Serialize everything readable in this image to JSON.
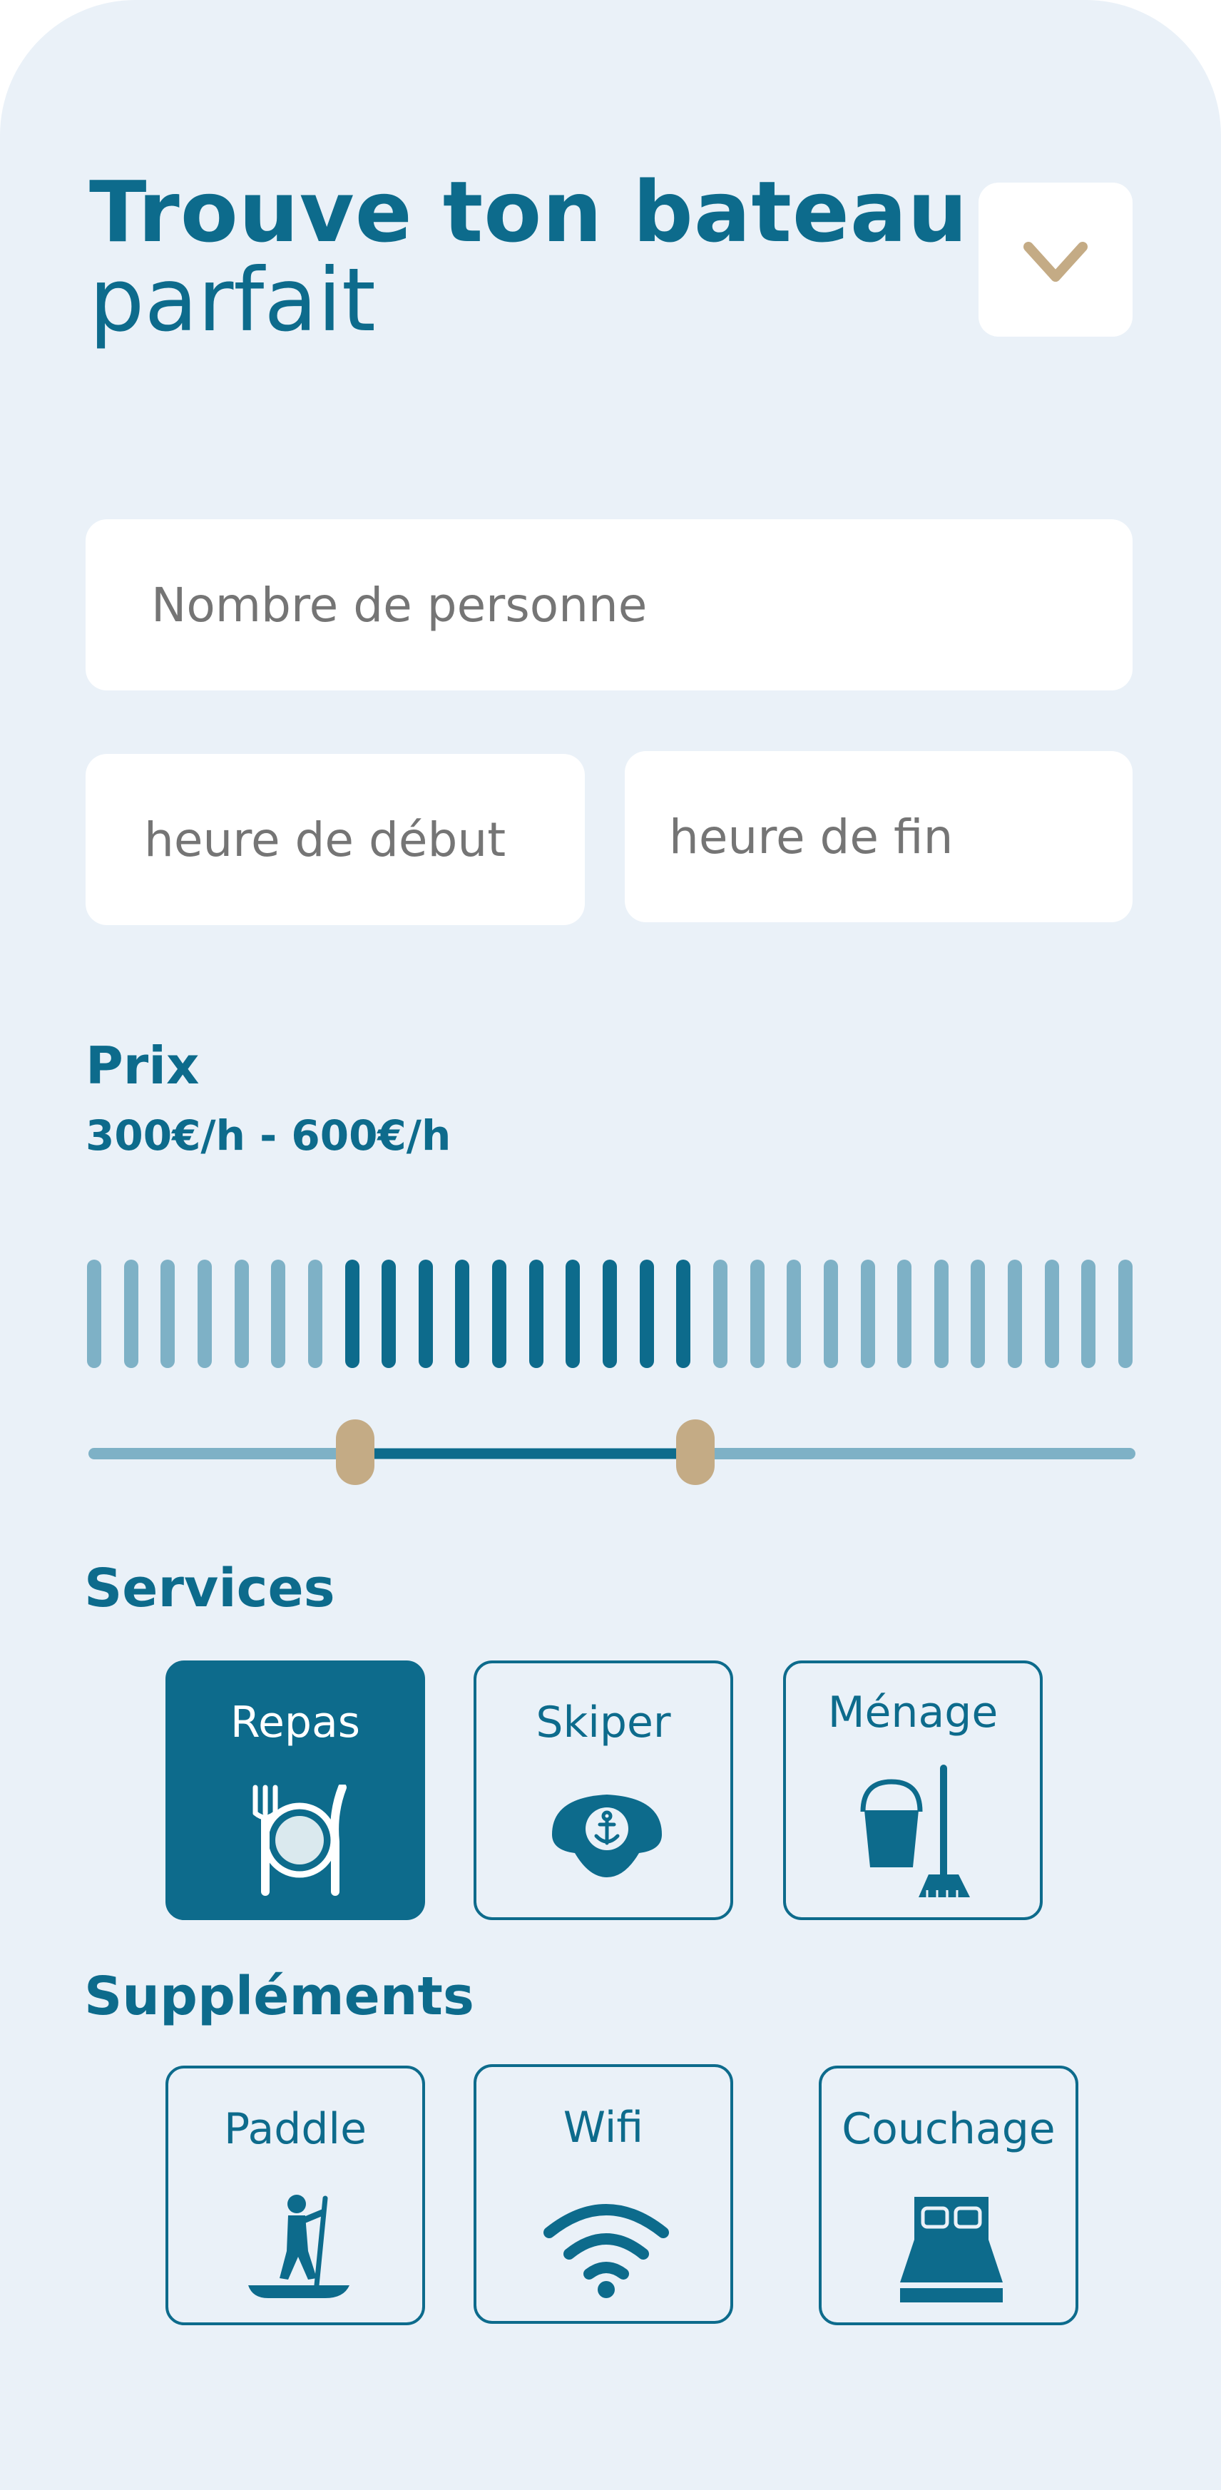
{
  "header": {
    "title_bold": "Trouve ton bateau",
    "title_light": "parfait",
    "dropdown_icon": "chevron-down-icon"
  },
  "form": {
    "persons_placeholder": "Nombre de personne",
    "start_placeholder": "heure de début",
    "end_placeholder": "heure de fin"
  },
  "price": {
    "label": "Prix",
    "range_text": "300€/h - 600€/h",
    "histogram_bar_count": 29,
    "selected_bar_first": 7,
    "selected_bar_last": 16,
    "slider_low_fraction": 0.255,
    "slider_high_fraction": 0.58
  },
  "services": {
    "label": "Services",
    "items": [
      {
        "label": "Repas",
        "icon": "meal-icon",
        "selected": true
      },
      {
        "label": "Skiper",
        "icon": "captain-hat-icon",
        "selected": false
      },
      {
        "label": "Ménage",
        "icon": "cleaning-icon",
        "selected": false
      }
    ]
  },
  "supplements": {
    "label": "Suppléments",
    "items": [
      {
        "label": "Paddle",
        "icon": "paddle-icon",
        "selected": false
      },
      {
        "label": "Wifi",
        "icon": "wifi-icon",
        "selected": false
      },
      {
        "label": "Couchage",
        "icon": "bed-icon",
        "selected": false
      }
    ]
  },
  "colors": {
    "primary": "#0d6b8c",
    "accent": "#c4ab85",
    "muted": "#7eb1c6",
    "background": "#eaf1f8",
    "surface": "#ffffff"
  }
}
